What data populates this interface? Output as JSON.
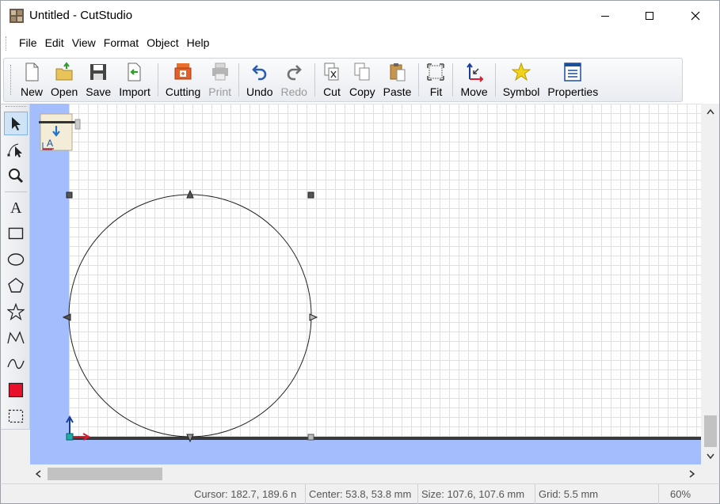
{
  "window": {
    "title": "Untitled - CutStudio",
    "app_icon": "cutstudio-app-icon",
    "controls": [
      "minimize-icon",
      "maximize-icon",
      "close-icon"
    ]
  },
  "menu": {
    "items": [
      "File",
      "Edit",
      "View",
      "Format",
      "Object",
      "Help"
    ]
  },
  "toolbar": {
    "buttons": [
      {
        "label": "New",
        "icon": "new-document-icon",
        "enabled": true
      },
      {
        "label": "Open",
        "icon": "open-folder-icon",
        "enabled": true
      },
      {
        "label": "Save",
        "icon": "save-disk-icon",
        "enabled": true
      },
      {
        "label": "Import",
        "icon": "import-icon",
        "enabled": true
      },
      {
        "label": "Cutting",
        "icon": "cutting-plotter-icon",
        "enabled": true
      },
      {
        "label": "Print",
        "icon": "printer-icon",
        "enabled": false
      },
      {
        "label": "Undo",
        "icon": "undo-icon",
        "enabled": true
      },
      {
        "label": "Redo",
        "icon": "redo-icon",
        "enabled": false
      },
      {
        "label": "Cut",
        "icon": "cut-icon",
        "enabled": true
      },
      {
        "label": "Copy",
        "icon": "copy-icon",
        "enabled": true
      },
      {
        "label": "Paste",
        "icon": "paste-icon",
        "enabled": true
      },
      {
        "label": "Fit",
        "icon": "fit-icon",
        "enabled": true
      },
      {
        "label": "Move",
        "icon": "move-icon",
        "enabled": true
      },
      {
        "label": "Symbol",
        "icon": "star-symbol-icon",
        "enabled": true
      },
      {
        "label": "Properties",
        "icon": "properties-icon",
        "enabled": true
      }
    ]
  },
  "tools": [
    {
      "name": "select-tool",
      "icon": "arrow-pointer-icon",
      "active": true
    },
    {
      "name": "edit-points-tool",
      "icon": "node-edit-icon",
      "active": false
    },
    {
      "name": "zoom-tool",
      "icon": "magnifier-icon",
      "active": false
    },
    {
      "name": "text-tool",
      "icon": "text-a-icon",
      "active": false
    },
    {
      "name": "rectangle-tool",
      "icon": "rectangle-icon",
      "active": false
    },
    {
      "name": "ellipse-tool",
      "icon": "ellipse-icon",
      "active": false
    },
    {
      "name": "polygon-tool",
      "icon": "pentagon-icon",
      "active": false
    },
    {
      "name": "star-tool",
      "icon": "star-outline-icon",
      "active": false
    },
    {
      "name": "polyline-tool",
      "icon": "polyline-icon",
      "active": false
    },
    {
      "name": "curve-tool",
      "icon": "curve-icon",
      "active": false
    },
    {
      "name": "fill-color-tool",
      "icon": "red-fill-swatch-icon",
      "active": false
    },
    {
      "name": "marquee-tool",
      "icon": "dashed-rectangle-icon",
      "active": false
    }
  ],
  "canvas": {
    "shape": "circle",
    "selected": true,
    "colors": {
      "page_background": "#ffffff",
      "outside_area": "#a4bdfc",
      "grid_line": "#e0e0e0",
      "baseline": "#3a3a3a"
    }
  },
  "status": {
    "cursor": "Cursor: 182.7, 189.6 n",
    "center": "Center: 53.8, 53.8 mm",
    "size": "Size: 107.6, 107.6 mm",
    "grid": "Grid: 5.5 mm",
    "zoom": "60%"
  }
}
